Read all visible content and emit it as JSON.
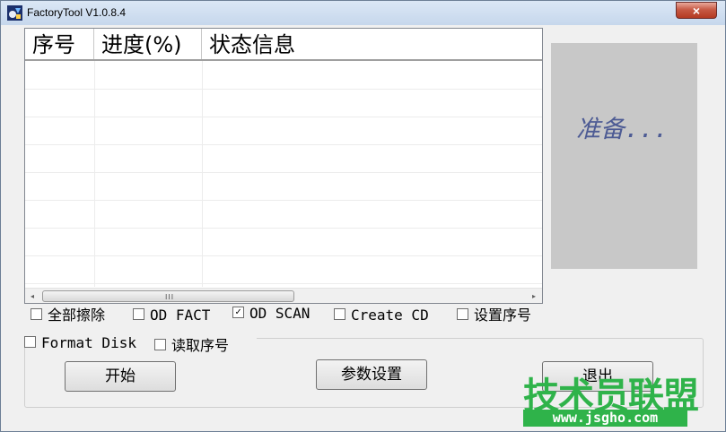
{
  "window": {
    "title": "FactoryTool V1.0.8.4",
    "close_label": "×"
  },
  "list": {
    "columns": [
      "序号",
      "进度(%)",
      "状态信息"
    ],
    "scroll_left": "◂",
    "scroll_right": "▸",
    "grip": "III"
  },
  "status_panel": {
    "text": "准备..."
  },
  "options": {
    "full_erase": "全部擦除",
    "od_fact": "OD FACT",
    "od_scan": "OD SCAN",
    "create_cd": "Create CD",
    "set_serial": "设置序号",
    "format_disk": "Format Disk",
    "read_serial": "读取序号",
    "od_scan_checked": true,
    "check_glyph": "✓"
  },
  "buttons": {
    "start": "开始",
    "settings": "参数设置",
    "exit": "退出"
  },
  "watermark": {
    "title": "技术员联盟",
    "url": "www.jsgho.com"
  },
  "colors": {
    "status_bg": "#c8c8c8",
    "status_text": "#4d5b94",
    "watermark": "#2fb34a"
  }
}
